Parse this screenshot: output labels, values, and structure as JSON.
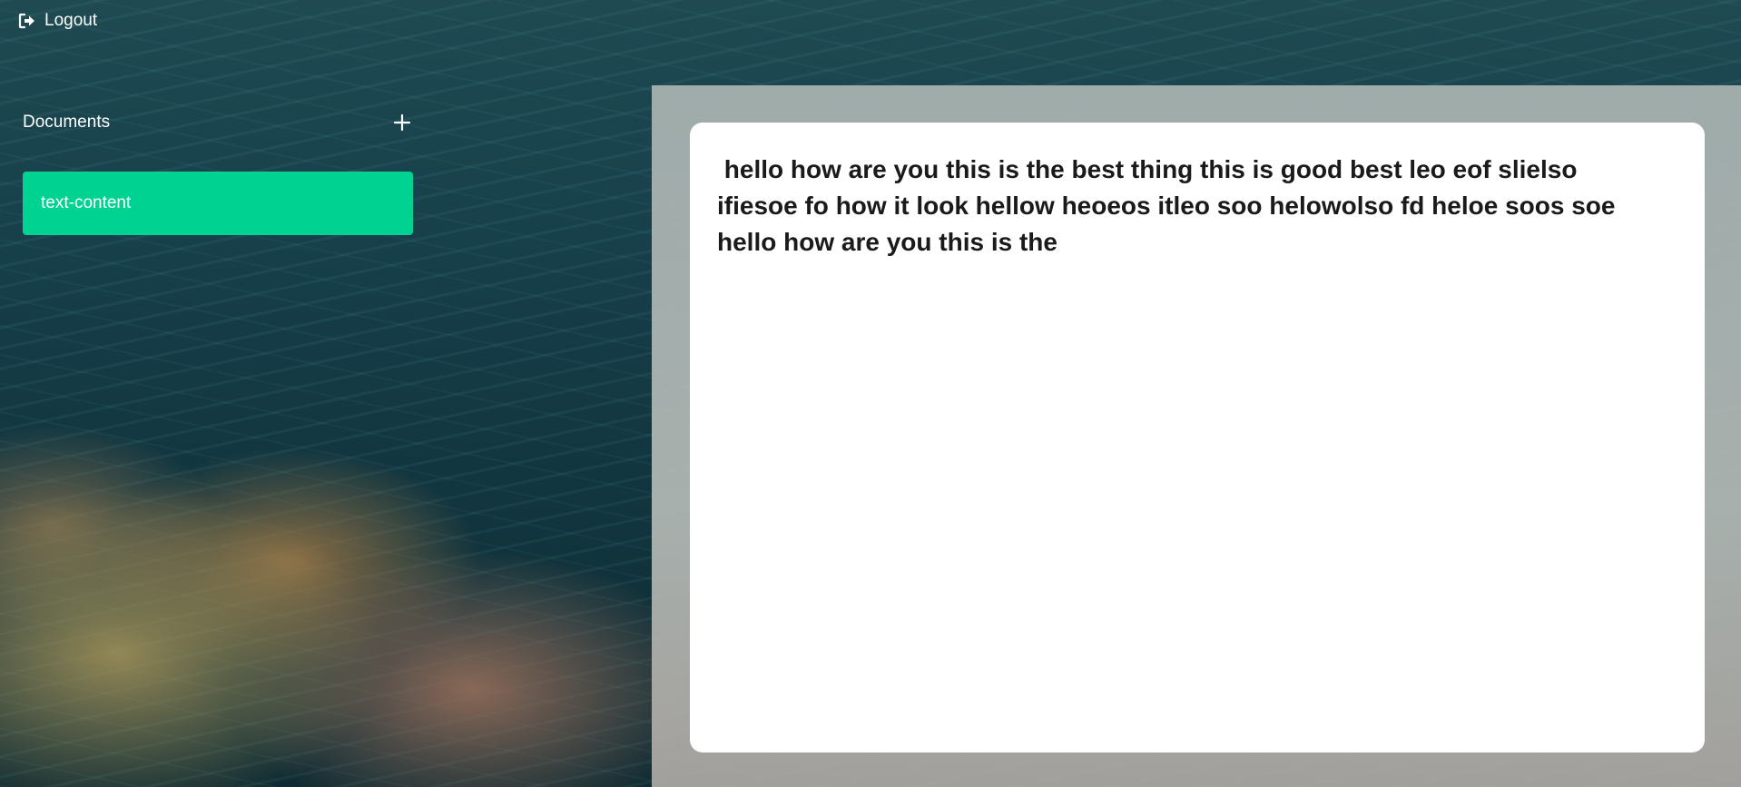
{
  "topbar": {
    "logout_label": "Logout",
    "logout_icon": "sign-out-icon"
  },
  "sidebar": {
    "title": "Documents",
    "add_icon": "plus-icon",
    "documents": [
      {
        "name": "text-content",
        "selected": true
      }
    ]
  },
  "editor": {
    "content": " hello how are you this is the best thing this is good best leo eof slielso ifiesoe fo how it look hellow heoeos itleo soo helowolso fd heloe soos soe hello how are you this is the"
  },
  "colors": {
    "accent": "#00d391",
    "editor_background": "#ffffff",
    "text": "#1a1a1a"
  }
}
